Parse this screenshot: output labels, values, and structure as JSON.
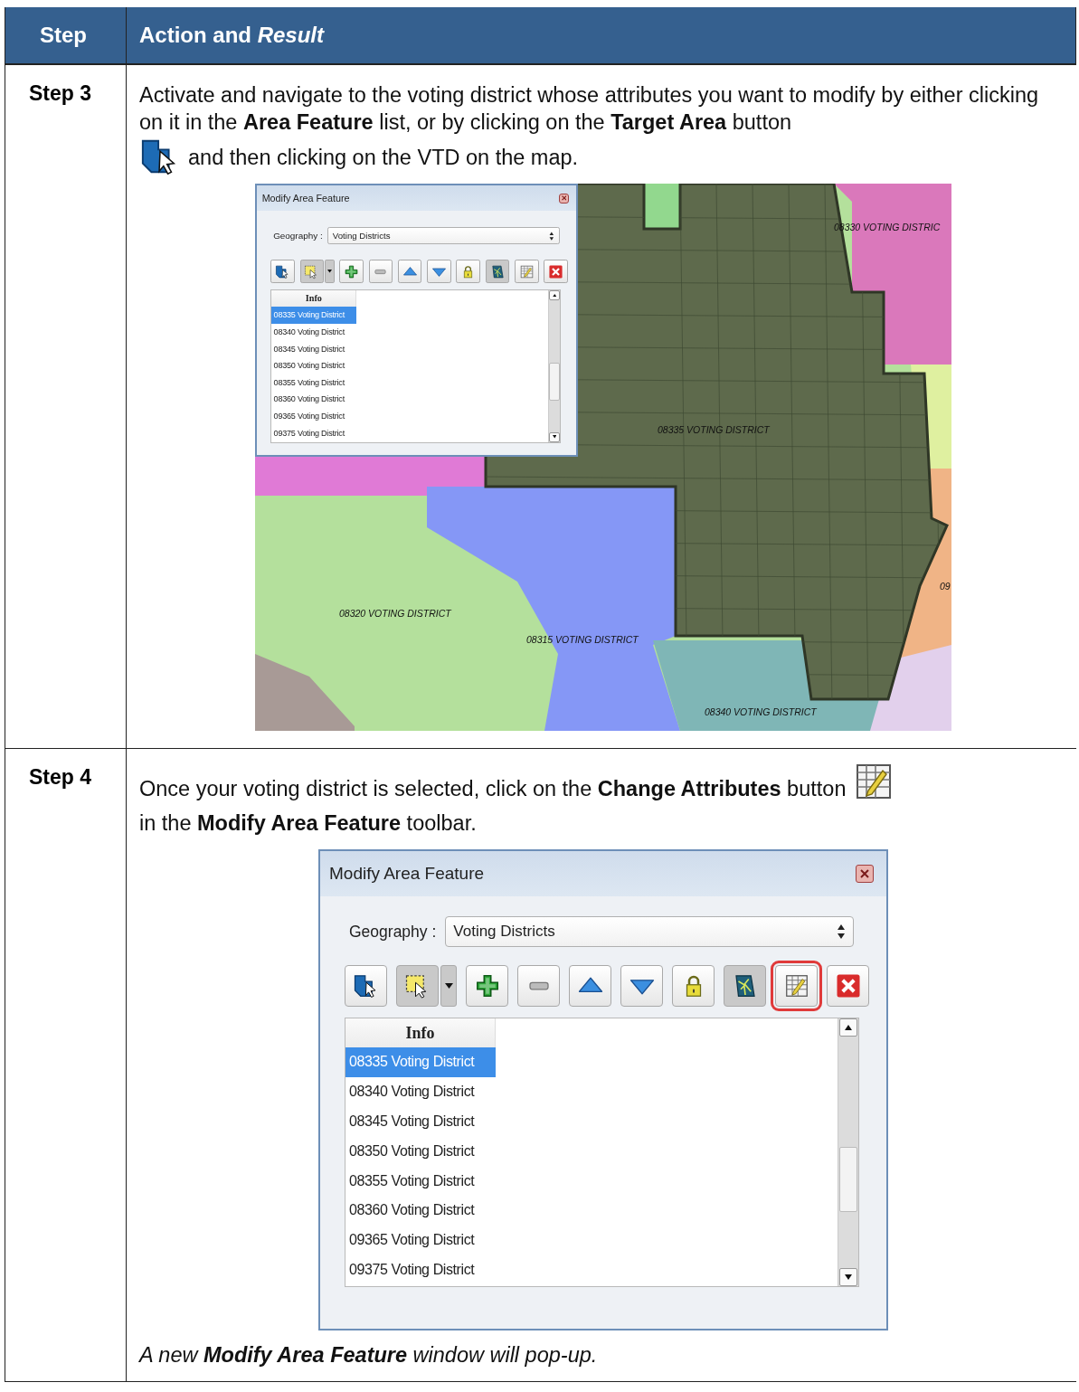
{
  "table": {
    "header": {
      "step": "Step",
      "action": "Action and *Result*"
    },
    "rows": [
      {
        "step": "Step 3",
        "text_before": "Activate and navigate to the voting district whose attributes you want to modify by either clicking on it in the **Area Feature** list, or by clicking on the **Target Area** button",
        "text_after": "and then clicking on the VTD on the map.",
        "map_labels": [
          "08330 VOTING DISTRIC",
          "08335 VOTING DISTRICT",
          "08320 VOTING DISTRICT",
          "08315 VOTING DISTRICT",
          "08340 VOTING DISTRICT",
          "09"
        ],
        "dialog": {
          "title": "Modify Area Feature",
          "geography_label": "Geography :",
          "geography_value": "Voting Districts",
          "list_header": "Info",
          "tools": [
            {
              "kind": "target",
              "highlighted": false
            },
            {
              "kind": "select",
              "highlighted": false
            },
            {
              "kind": "add",
              "highlighted": false
            },
            {
              "kind": "remove",
              "highlighted": false
            },
            {
              "kind": "up",
              "highlighted": false
            },
            {
              "kind": "down",
              "highlighted": false
            },
            {
              "kind": "lock",
              "highlighted": false
            },
            {
              "kind": "map",
              "highlighted": false
            },
            {
              "kind": "attributes",
              "highlighted": false
            },
            {
              "kind": "delete",
              "highlighted": false
            }
          ],
          "items": [
            {
              "label": "08335 Voting District",
              "selected": true
            },
            {
              "label": "08340 Voting District",
              "selected": false
            },
            {
              "label": "08345 Voting District",
              "selected": false
            },
            {
              "label": "08350 Voting District",
              "selected": false
            },
            {
              "label": "08355 Voting District",
              "selected": false
            },
            {
              "label": "08360 Voting District",
              "selected": false
            },
            {
              "label": "09365 Voting District",
              "selected": false
            },
            {
              "label": "09375 Voting District",
              "selected": false
            }
          ]
        }
      },
      {
        "step": "Step 4",
        "text_before": "Once your voting district is selected, click on the **Change Attributes** button",
        "text_after": "in the **Modify Area Feature** toolbar.",
        "dialog": {
          "title": "Modify Area Feature",
          "geography_label": "Geography :",
          "geography_value": "Voting Districts",
          "list_header": "Info",
          "tools": [
            {
              "kind": "target",
              "highlighted": false
            },
            {
              "kind": "select",
              "highlighted": false
            },
            {
              "kind": "add",
              "highlighted": false
            },
            {
              "kind": "remove",
              "highlighted": false
            },
            {
              "kind": "up",
              "highlighted": false
            },
            {
              "kind": "down",
              "highlighted": false
            },
            {
              "kind": "lock",
              "highlighted": false
            },
            {
              "kind": "map",
              "highlighted": false
            },
            {
              "kind": "attributes",
              "highlighted": true
            },
            {
              "kind": "delete",
              "highlighted": false
            }
          ],
          "items": [
            {
              "label": "08335 Voting District",
              "selected": true
            },
            {
              "label": "08340 Voting District",
              "selected": false
            },
            {
              "label": "08345 Voting District",
              "selected": false
            },
            {
              "label": "08350 Voting District",
              "selected": false
            },
            {
              "label": "08355 Voting District",
              "selected": false
            },
            {
              "label": "08360 Voting District",
              "selected": false
            },
            {
              "label": "09365 Voting District",
              "selected": false
            },
            {
              "label": "09375 Voting District",
              "selected": false
            }
          ]
        },
        "note": "A new **Modify Area Feature** window will pop-up."
      }
    ]
  }
}
